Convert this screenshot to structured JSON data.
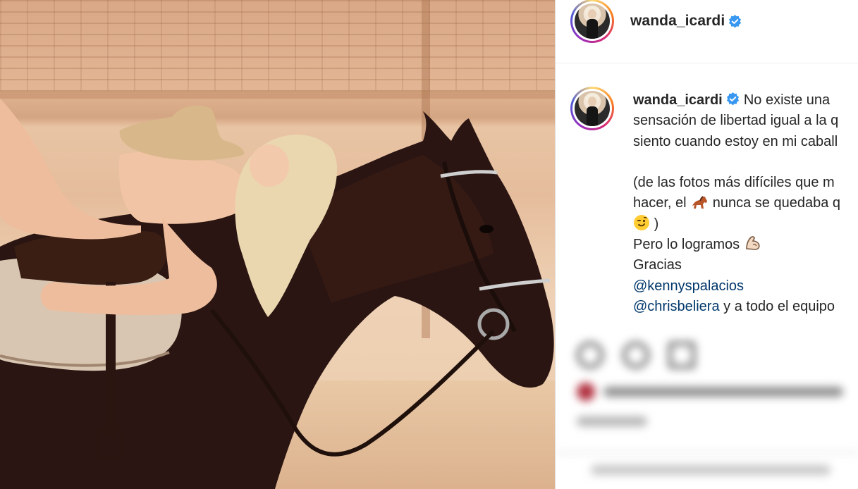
{
  "post": {
    "username": "wanda_icardi",
    "verified_icon": "verified-badge-icon",
    "caption": {
      "line1": "No existe una",
      "line2": "sensación de libertad igual a la q",
      "line3": "siento cuando estoy en mi caball",
      "line4": "(de las fotos más difíciles que m",
      "line5_pre": "hacer, el",
      "line5_post": "nunca se quedaba q",
      "line6_post": ")",
      "line7": "Pero lo logramos",
      "line8": "Gracias",
      "mention1": "@kennyspalacios",
      "mention2": "@chrisbeliera",
      "line10_post": "y a todo el equipo"
    },
    "emojis": [
      "horse-emoji",
      "winking-face-emoji",
      "flexed-biceps-emoji"
    ]
  },
  "colors": {
    "text": "#262626",
    "mention": "#00376b",
    "verified": "#3897f0",
    "border": "#dbdbdb"
  }
}
